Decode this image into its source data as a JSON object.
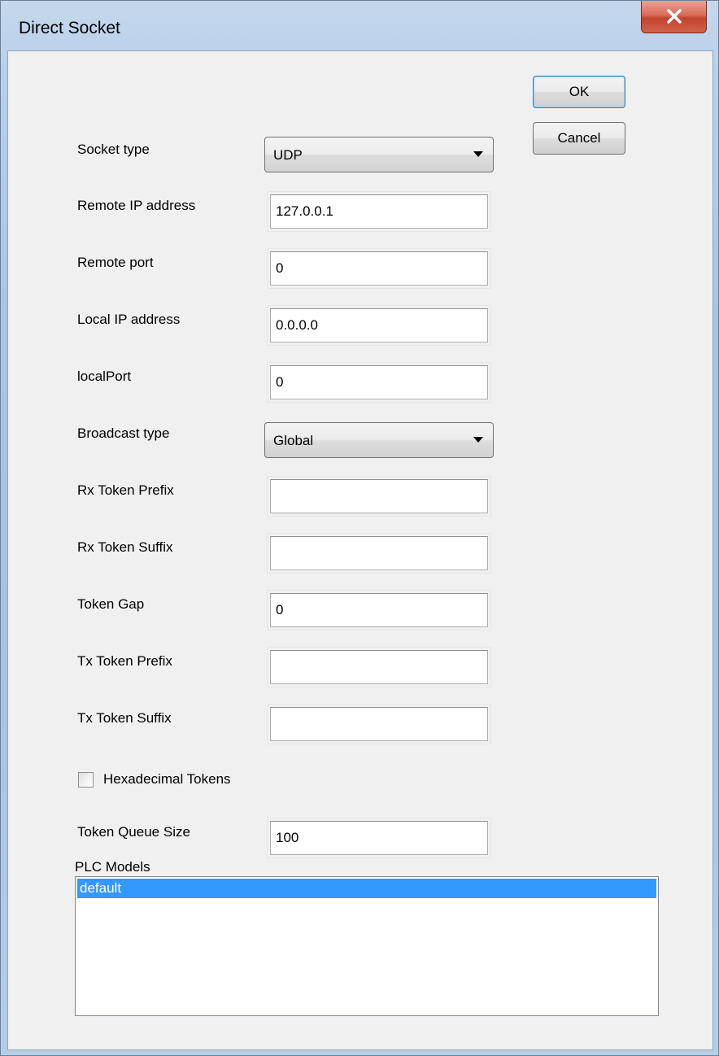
{
  "window": {
    "title": "Direct Socket"
  },
  "buttons": {
    "ok": "OK",
    "cancel": "Cancel"
  },
  "fields": {
    "socket_type": {
      "label": "Socket type",
      "value": "UDP"
    },
    "remote_ip": {
      "label": "Remote IP address",
      "value": "127.0.0.1"
    },
    "remote_port": {
      "label": "Remote port",
      "value": "0"
    },
    "local_ip": {
      "label": "Local IP address",
      "value": "0.0.0.0"
    },
    "local_port": {
      "label": "localPort",
      "value": "0"
    },
    "broadcast_type": {
      "label": "Broadcast type",
      "value": "Global"
    },
    "rx_prefix": {
      "label": "Rx Token Prefix",
      "value": ""
    },
    "rx_suffix": {
      "label": "Rx Token Suffix",
      "value": ""
    },
    "token_gap": {
      "label": "Token Gap",
      "value": "0"
    },
    "tx_prefix": {
      "label": "Tx Token Prefix",
      "value": ""
    },
    "tx_suffix": {
      "label": "Tx Token Suffix",
      "value": ""
    },
    "hex_tokens": {
      "label": "Hexadecimal Tokens",
      "checked": false
    },
    "queue_size": {
      "label": "Token Queue Size",
      "value": "100"
    }
  },
  "plc_models": {
    "label": "PLC Models",
    "items": [
      "default"
    ],
    "selected": "default"
  },
  "colors": {
    "selection": "#3399ff",
    "dialog_bg": "#f0f0f0",
    "close_button": "#c4432c"
  },
  "icons": {
    "close": "close-icon",
    "dropdown": "chevron-down-icon"
  }
}
